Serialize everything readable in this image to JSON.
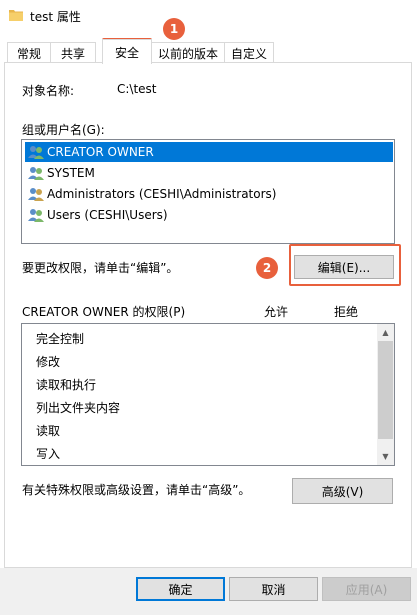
{
  "window": {
    "title": "test 属性"
  },
  "tabs": [
    {
      "label": "常规"
    },
    {
      "label": "共享"
    },
    {
      "label": "安全"
    },
    {
      "label": "以前的版本"
    },
    {
      "label": "自定义"
    }
  ],
  "security": {
    "object_name_label": "对象名称:",
    "object_name_value": "C:\\test",
    "group_label": "组或用户名(G):",
    "users": [
      {
        "name": "CREATOR OWNER"
      },
      {
        "name": "SYSTEM"
      },
      {
        "name": "Administrators (CESHI\\Administrators)"
      },
      {
        "name": "Users (CESHI\\Users)"
      }
    ],
    "change_hint": "要更改权限，请单击“编辑”。",
    "edit_button": "编辑(E)...",
    "perm_header": "CREATOR OWNER 的权限(P)",
    "allow_header": "允许",
    "deny_header": "拒绝",
    "permissions": [
      {
        "name": "完全控制"
      },
      {
        "name": "修改"
      },
      {
        "name": "读取和执行"
      },
      {
        "name": "列出文件夹内容"
      },
      {
        "name": "读取"
      },
      {
        "name": "写入"
      }
    ],
    "advanced_hint": "有关特殊权限或高级设置，请单击“高级”。",
    "advanced_button": "高级(V)"
  },
  "footer": {
    "ok": "确定",
    "cancel": "取消",
    "apply": "应用(A)"
  },
  "annotations": {
    "badge1": "1",
    "badge2": "2"
  },
  "colors": {
    "accent": "#0078d7",
    "highlight": "#e8603c"
  }
}
